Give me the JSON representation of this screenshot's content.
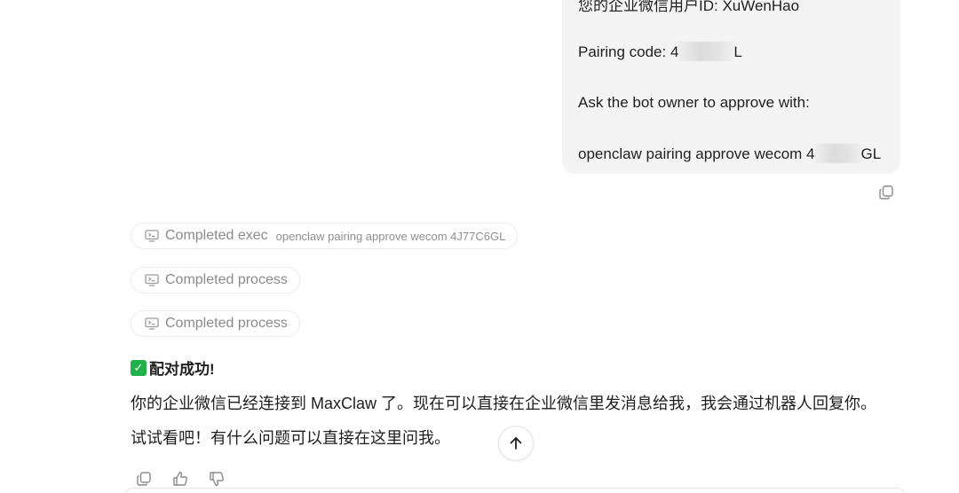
{
  "user_message": {
    "lines": [
      "您的企业微信用户ID: XuWenHao",
      "Pairing code: 4",
      "L",
      "Ask the bot owner to approve with:",
      "openclaw pairing approve wecom 4",
      "GL"
    ]
  },
  "tool_calls": [
    {
      "label": "Completed exec",
      "command": "openclaw pairing approve wecom 4J77C6GL"
    },
    {
      "label": "Completed process",
      "command": ""
    },
    {
      "label": "Completed process",
      "command": ""
    }
  ],
  "assistant_reply": {
    "title": "配对成功!",
    "line1": "你的企业微信已经连接到 MaxClaw 了。现在可以直接在企业微信里发消息给我，我会通过机器人回复你。",
    "line2": "试试看吧！有什么问题可以直接在这里问我。"
  },
  "icons": {
    "copy": "copy-icon",
    "terminal": "terminal-icon",
    "check": "check-mark-icon",
    "arrow_up": "arrow-up-icon",
    "thumbs_up": "thumbs-up-icon",
    "thumbs_down": "thumbs-down-icon"
  },
  "colors": {
    "bubble_bg": "#f4f4f5",
    "check_green": "#22b04b",
    "muted_text": "#8a8a8a"
  }
}
